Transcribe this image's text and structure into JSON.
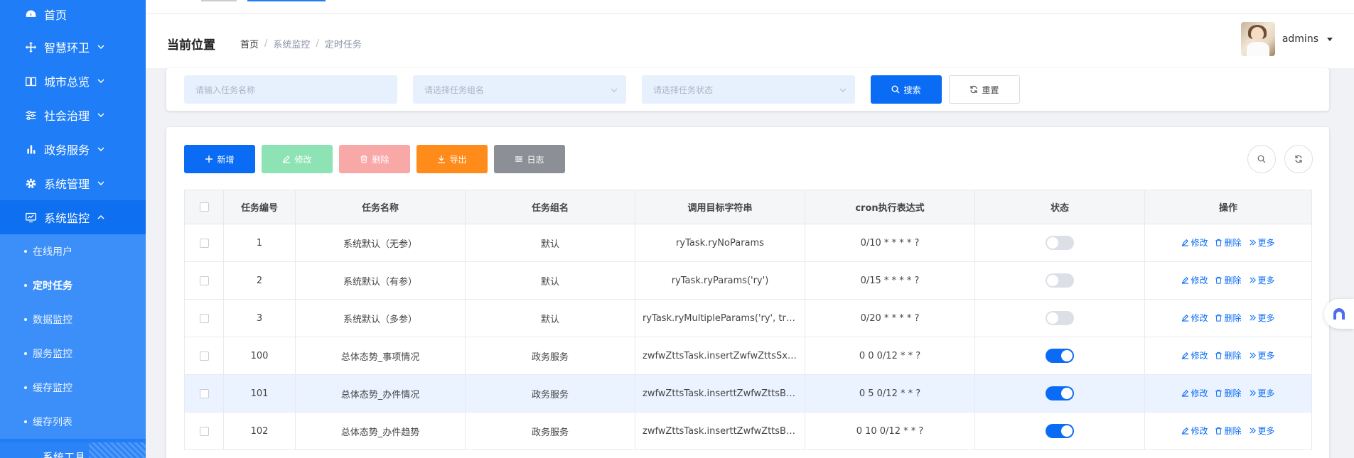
{
  "sidebar": {
    "home": "首页",
    "items": [
      {
        "label": "智慧环卫",
        "icon": "move-icon"
      },
      {
        "label": "城市总览",
        "icon": "book-icon"
      },
      {
        "label": "社会治理",
        "icon": "sliders-icon"
      },
      {
        "label": "政务服务",
        "icon": "bar-chart-icon"
      },
      {
        "label": "系统管理",
        "icon": "gear-icon"
      },
      {
        "label": "系统监控",
        "icon": "monitor-icon"
      }
    ],
    "submenu": [
      "在线用户",
      "定时任务",
      "数据监控",
      "服务监控",
      "缓存监控",
      "缓存列表"
    ],
    "bottom_label": "系统工具"
  },
  "header": {
    "current_position": "当前位置",
    "breadcrumb": [
      "首页",
      "系统监控",
      "定时任务"
    ],
    "username": "admins"
  },
  "search": {
    "task_name_placeholder": "请输入任务名称",
    "task_group_placeholder": "请选择任务组名",
    "task_status_placeholder": "请选择任务状态",
    "search_label": "搜索",
    "reset_label": "重置"
  },
  "toolbar": {
    "add": "新增",
    "edit": "修改",
    "delete": "删除",
    "export": "导出",
    "log": "日志"
  },
  "table": {
    "columns": [
      "任务编号",
      "任务名称",
      "任务组名",
      "调用目标字符串",
      "cron执行表达式",
      "状态",
      "操作"
    ],
    "rows": [
      {
        "id": "1",
        "name": "系统默认（无参）",
        "group": "默认",
        "target": "ryTask.ryNoParams",
        "cron": "0/10 * * * * ?",
        "status": false
      },
      {
        "id": "2",
        "name": "系统默认（有参）",
        "group": "默认",
        "target": "ryTask.ryParams('ry')",
        "cron": "0/15 * * * * ?",
        "status": false
      },
      {
        "id": "3",
        "name": "系统默认（多参）",
        "group": "默认",
        "target": "ryTask.ryMultipleParams('ry', tru...",
        "cron": "0/20 * * * * ?",
        "status": false
      },
      {
        "id": "100",
        "name": "总体态势_事项情况",
        "group": "政务服务",
        "target": "zwfwZttsTask.insertZwfwZttsSxq...",
        "cron": "0 0 0/12 * * ?",
        "status": true
      },
      {
        "id": "101",
        "name": "总体态势_办件情况",
        "group": "政务服务",
        "target": "zwfwZttsTask.inserttZwfwZttsBjq...",
        "cron": "0 5 0/12 * * ?",
        "status": true
      },
      {
        "id": "102",
        "name": "总体态势_办件趋势",
        "group": "政务服务",
        "target": "zwfwZttsTask.inserttZwfwZttsBjq...",
        "cron": "0 10 0/12 * * ?",
        "status": true
      }
    ],
    "highlighted_row": 4,
    "ops": {
      "edit": "修改",
      "delete": "删除",
      "more": "更多"
    }
  },
  "colors": {
    "primary": "#0a6cf5",
    "sidebar": "#1f7df7",
    "success_light": "#8ee3b4",
    "danger_light": "#f9a8a8",
    "warning": "#ff8c1a",
    "info": "#8c8f96"
  }
}
